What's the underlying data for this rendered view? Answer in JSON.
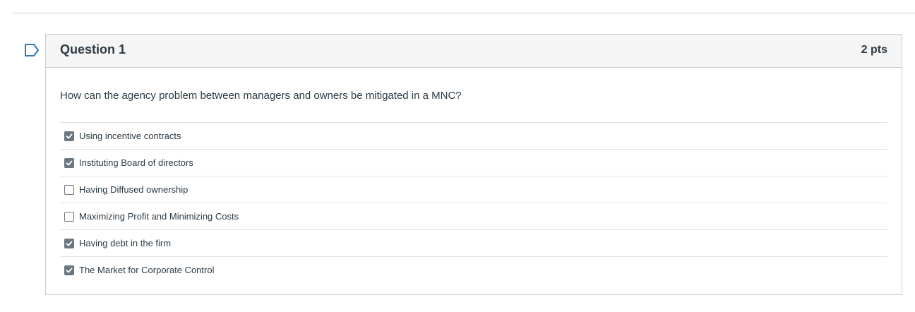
{
  "question": {
    "title": "Question 1",
    "points": "2 pts",
    "text": "How can the agency problem between managers and owners be mitigated in a MNC?",
    "answers": [
      {
        "label": "Using incentive contracts",
        "checked": true
      },
      {
        "label": "Instituting Board of directors",
        "checked": true
      },
      {
        "label": "Having Diffused ownership",
        "checked": false
      },
      {
        "label": "Maximizing Profit and Minimizing Costs",
        "checked": false
      },
      {
        "label": "Having debt in the firm",
        "checked": true
      },
      {
        "label": "The Market for Corporate Control",
        "checked": true
      }
    ]
  },
  "colors": {
    "flag": "#2b7abc",
    "checkbox_checked": "#6b7780",
    "header_bg": "#f5f5f5",
    "border": "#c7cdd1"
  }
}
